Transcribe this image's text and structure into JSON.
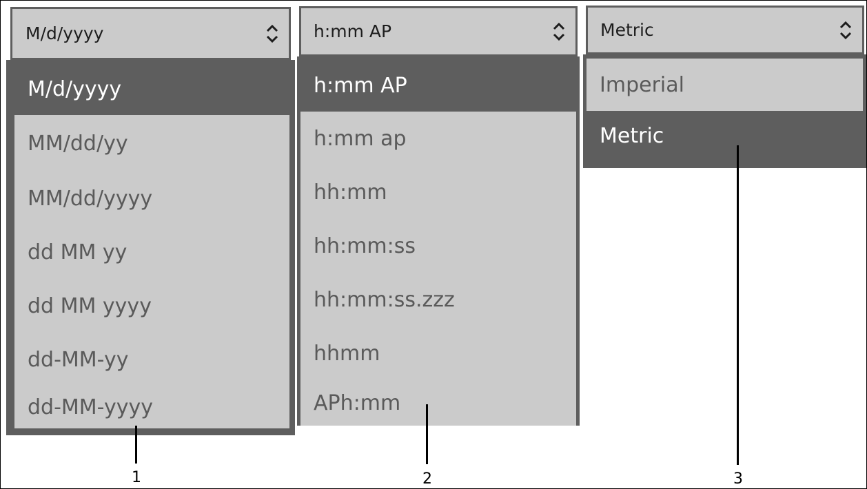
{
  "dropdowns": [
    {
      "current": "M/d/yyyy",
      "options": [
        "M/d/yyyy",
        "MM/dd/yy",
        "MM/dd/yyyy",
        "dd MM yy",
        "dd MM yyyy",
        "dd-MM-yy",
        "dd-MM-yyyy"
      ],
      "selected_index": 0,
      "callout": "1"
    },
    {
      "current": "h:mm AP",
      "options": [
        "h:mm AP",
        "h:mm ap",
        "hh:mm",
        "hh:mm:ss",
        "hh:mm:ss.zzz",
        "hhmm",
        "APh:mm"
      ],
      "selected_index": 0,
      "callout": "2"
    },
    {
      "current": "Metric",
      "options": [
        "Imperial",
        "Metric"
      ],
      "selected_index": 1,
      "callout": "3"
    }
  ],
  "colors": {
    "item_bg": "#cbcbcb",
    "selected_bg": "#5e5e5e",
    "selected_text": "#ffffff",
    "item_text": "#5a5a5a",
    "header_text": "#1d1d1d"
  }
}
